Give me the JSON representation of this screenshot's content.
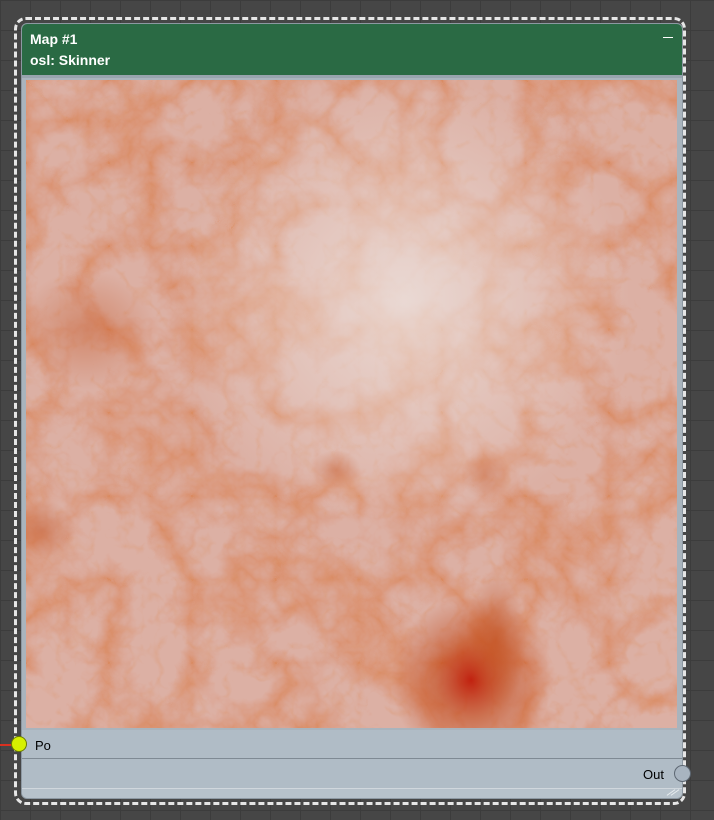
{
  "node": {
    "title": "Map #1",
    "subtitle": "osl: Skinner",
    "minimize_icon": "minimize-icon",
    "header_color": "#2a6a44",
    "preview": {
      "kind": "procedural-texture",
      "base_color": "#e2c0b6",
      "vein_color": "#b2401c",
      "hot_color": "#c01a08"
    },
    "ports": {
      "input_label": "Po",
      "input_color": "#d6f000",
      "output_label": "Out",
      "output_color": "#a8b4c0"
    },
    "connection_color": "#d93020"
  }
}
